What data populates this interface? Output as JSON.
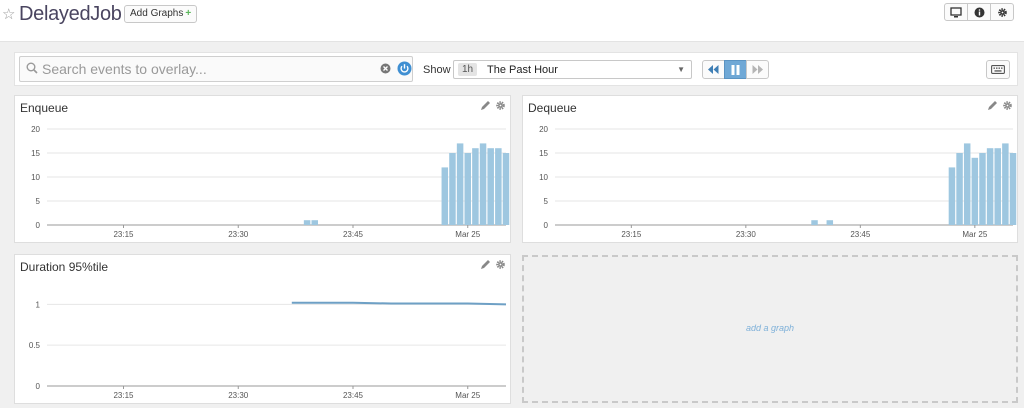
{
  "header": {
    "title": "DelayedJob",
    "add_graphs_label": "Add Graphs",
    "add_graphs_plus": "+"
  },
  "toolbar": {
    "search_placeholder": "Search events to overlay...",
    "show_label": "Show",
    "time_badge": "1h",
    "time_text": "The Past Hour"
  },
  "icons": {
    "star": "star-outline-icon",
    "monitor": "monitor-icon",
    "info": "info-icon",
    "settings": "gear-icon",
    "search": "search-icon",
    "clear": "clear-circle-icon",
    "power": "power-icon",
    "rewind": "rewind-icon",
    "pause": "pause-icon",
    "forward": "fast-forward-icon",
    "keyboard": "keyboard-icon",
    "edit": "pencil-icon"
  },
  "colors": {
    "bar": "#9ec7e0",
    "line": "#6ea0c5",
    "accent": "#6fa8d6"
  },
  "chart_data": [
    {
      "name": "enqueue",
      "type": "bar",
      "title": "Enqueue",
      "x_ticks": [
        "23:15",
        "23:30",
        "23:45",
        "Mar 25"
      ],
      "y_ticks": [
        "20",
        "15",
        "10",
        "5",
        "0"
      ],
      "ylim": [
        0,
        20
      ],
      "x_min_minutes": 0,
      "x_max_minutes": 60,
      "x_tick_minutes": [
        10,
        25,
        40,
        55
      ],
      "bar_minutes": [
        34,
        35,
        52,
        53,
        54,
        55,
        56,
        57,
        58,
        59,
        60,
        61,
        62,
        63,
        64
      ],
      "values": [
        1,
        1,
        12,
        15,
        17,
        15,
        16,
        17,
        16,
        16,
        15,
        17,
        15,
        6,
        0
      ]
    },
    {
      "name": "dequeue",
      "type": "bar",
      "title": "Dequeue",
      "x_ticks": [
        "23:15",
        "23:30",
        "23:45",
        "Mar 25"
      ],
      "y_ticks": [
        "20",
        "15",
        "10",
        "5",
        "0"
      ],
      "ylim": [
        0,
        20
      ],
      "x_min_minutes": 0,
      "x_max_minutes": 60,
      "x_tick_minutes": [
        10,
        25,
        40,
        55
      ],
      "bar_minutes": [
        34,
        36,
        52,
        53,
        54,
        55,
        56,
        57,
        58,
        59,
        60,
        61,
        62,
        63,
        64
      ],
      "values": [
        1,
        1,
        12,
        15,
        17,
        14,
        15,
        16,
        16,
        17,
        15,
        17,
        16,
        5,
        0
      ]
    },
    {
      "name": "duration",
      "type": "line",
      "title": "Duration 95%tile",
      "x_ticks": [
        "23:15",
        "23:30",
        "23:45",
        "Mar 25"
      ],
      "y_ticks": [
        "1",
        "0.5",
        "0"
      ],
      "ylim": [
        0,
        1.2
      ],
      "x_min_minutes": 0,
      "x_max_minutes": 60,
      "x_tick_minutes": [
        10,
        25,
        40,
        55
      ],
      "points": [
        [
          32,
          1.02
        ],
        [
          40,
          1.02
        ],
        [
          45,
          1.01
        ],
        [
          50,
          1.01
        ],
        [
          55,
          1.01
        ],
        [
          60,
          1.0
        ]
      ]
    }
  ],
  "add_graph_label": "add a graph"
}
